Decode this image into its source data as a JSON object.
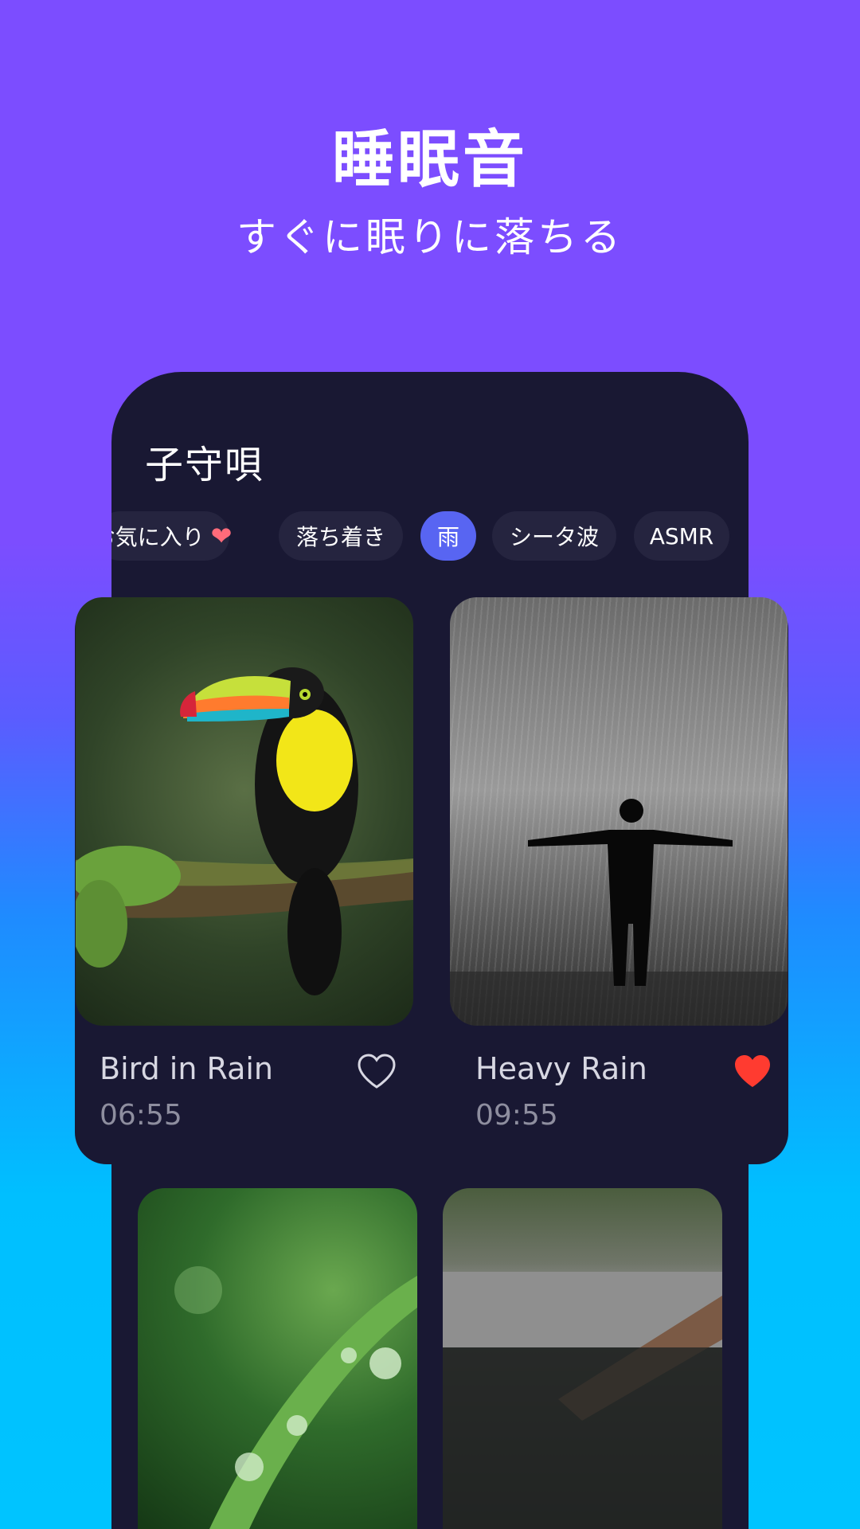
{
  "hero": {
    "title": "睡眠音",
    "subtitle": "すぐに眠りに落ちる"
  },
  "section": {
    "title": "子守唄"
  },
  "chips": [
    {
      "label": "お気に入り",
      "icon": "heart-icon",
      "active": false
    },
    {
      "label": "落ち着き",
      "active": false
    },
    {
      "label": "雨",
      "active": true
    },
    {
      "label": "シータ波",
      "active": false
    },
    {
      "label": "ASMR",
      "active": false
    }
  ],
  "cards": [
    {
      "title": "Bird in Rain",
      "duration": "06:55",
      "favorite": false,
      "image": "toucan-in-rain"
    },
    {
      "title": "Heavy Rain",
      "duration": "09:55",
      "favorite": true,
      "image": "man-under-heavy-rain"
    },
    {
      "image": "dew-drops-on-leaf"
    },
    {
      "image": "rain-dripping-off-roof"
    }
  ],
  "colors": {
    "accent": "#5865f2",
    "favorite_red": "#ff3b30",
    "panel": "#191833"
  }
}
